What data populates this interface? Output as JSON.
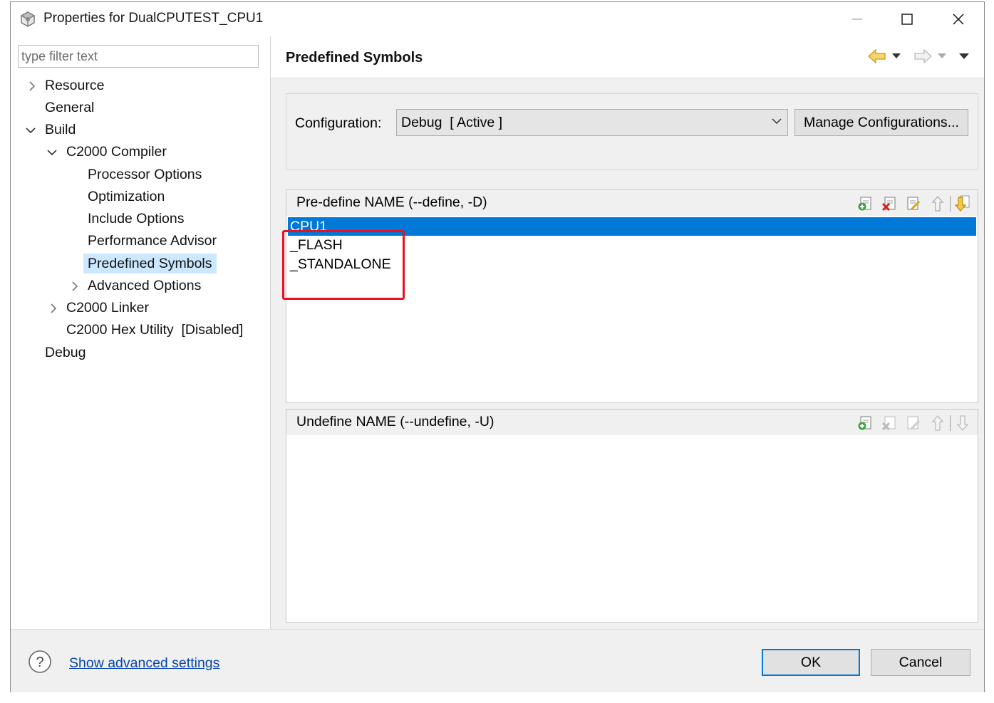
{
  "window": {
    "title": "Properties for DualCPUTEST_CPU1"
  },
  "filter": {
    "placeholder": "type filter text",
    "value": ""
  },
  "tree": {
    "items": [
      {
        "label": "Resource"
      },
      {
        "label": "General"
      },
      {
        "label": "Build"
      },
      {
        "label": "C2000 Compiler"
      },
      {
        "label": "Processor Options"
      },
      {
        "label": "Optimization"
      },
      {
        "label": "Include Options"
      },
      {
        "label": "Performance Advisor"
      },
      {
        "label": "Predefined Symbols"
      },
      {
        "label": "Advanced Options"
      },
      {
        "label": "C2000 Linker"
      },
      {
        "label": "C2000 Hex Utility  [Disabled]"
      },
      {
        "label": "Debug"
      }
    ]
  },
  "page": {
    "title": "Predefined Symbols"
  },
  "config": {
    "label": "Configuration:",
    "value": "Debug  [ Active ]",
    "manage_label": "Manage Configurations..."
  },
  "define": {
    "title": "Pre-define NAME (--define, -D)",
    "items": [
      "CPU1",
      "_FLASH",
      "_STANDALONE"
    ]
  },
  "undefine": {
    "title": "Undefine NAME (--undefine, -U)",
    "items": []
  },
  "footer": {
    "advanced_link": "Show advanced settings",
    "ok_label": "OK",
    "cancel_label": "Cancel"
  },
  "colors": {
    "selection": "#0078d7",
    "tree_selection": "#cce8ff",
    "highlight_box": "#e81123",
    "link": "#0645ad"
  }
}
